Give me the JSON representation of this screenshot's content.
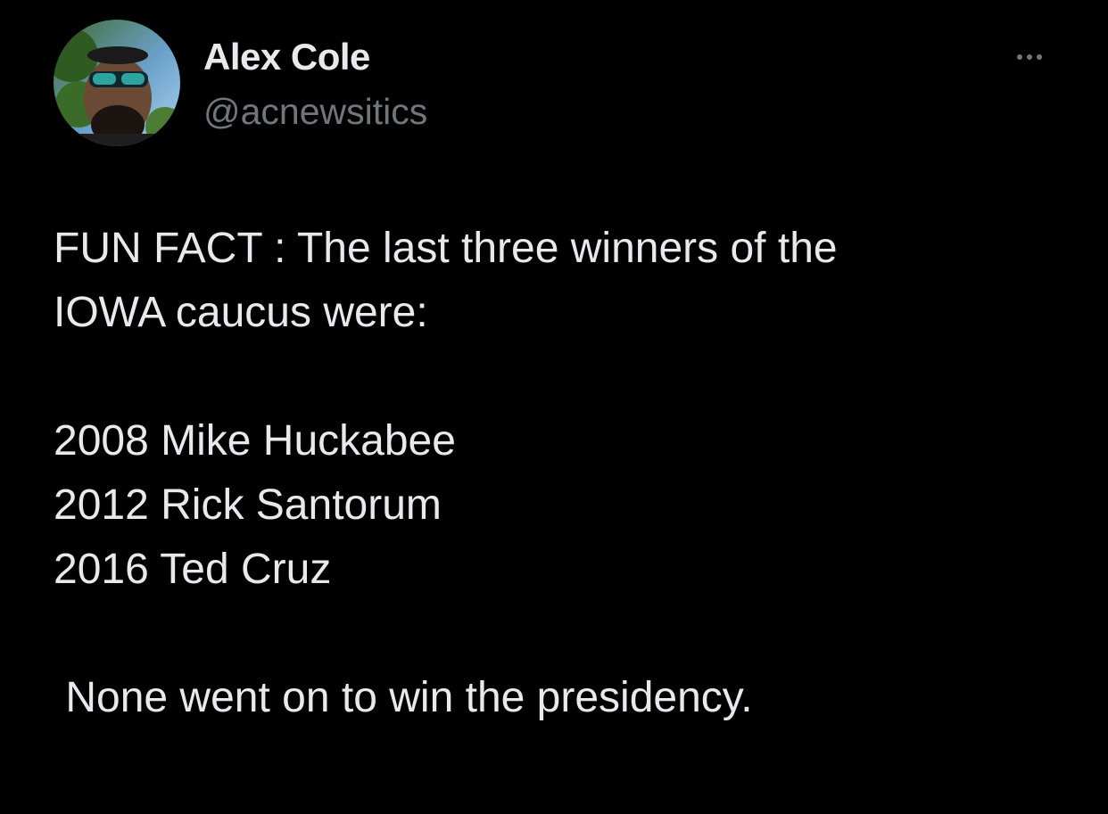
{
  "author": {
    "display_name": "Alex Cole",
    "handle": "@acnewsitics"
  },
  "menu": {
    "more_icon": "more-horizontal-icon"
  },
  "tweet": {
    "line_1": "FUN FACT : The last three winners of the",
    "line_2": "IOWA caucus were:",
    "winners": [
      "2008 Mike Huckabee",
      "2012 Rick Santorum",
      "2016 Ted Cruz"
    ],
    "closing": " None went on to win the presidency."
  },
  "colors": {
    "background": "#000000",
    "primary_text": "#e7e9ea",
    "secondary_text": "#71767b"
  }
}
